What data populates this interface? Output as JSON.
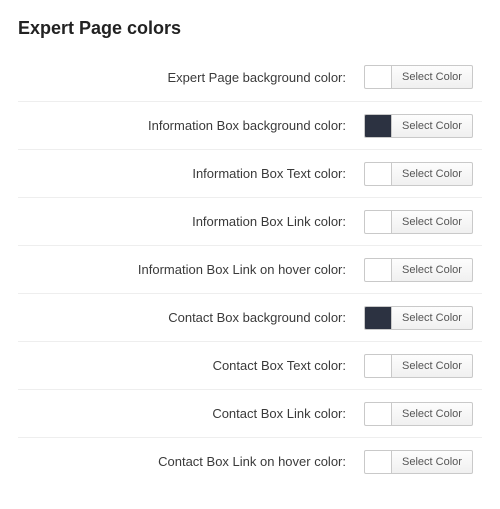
{
  "section": {
    "title": "Expert Page colors"
  },
  "button_label": "Select Color",
  "rows": [
    {
      "label": "Expert Page background color:",
      "swatch": "#ffffff"
    },
    {
      "label": "Information Box background color:",
      "swatch": "#2c3241"
    },
    {
      "label": "Information Box Text color:",
      "swatch": "#ffffff"
    },
    {
      "label": "Information Box Link color:",
      "swatch": "#ffffff"
    },
    {
      "label": "Information Box Link on hover color:",
      "swatch": "#ffffff"
    },
    {
      "label": "Contact Box background color:",
      "swatch": "#2c3241"
    },
    {
      "label": "Contact Box Text color:",
      "swatch": "#ffffff"
    },
    {
      "label": "Contact Box Link color:",
      "swatch": "#ffffff"
    },
    {
      "label": "Contact Box Link on hover color:",
      "swatch": "#ffffff"
    }
  ]
}
